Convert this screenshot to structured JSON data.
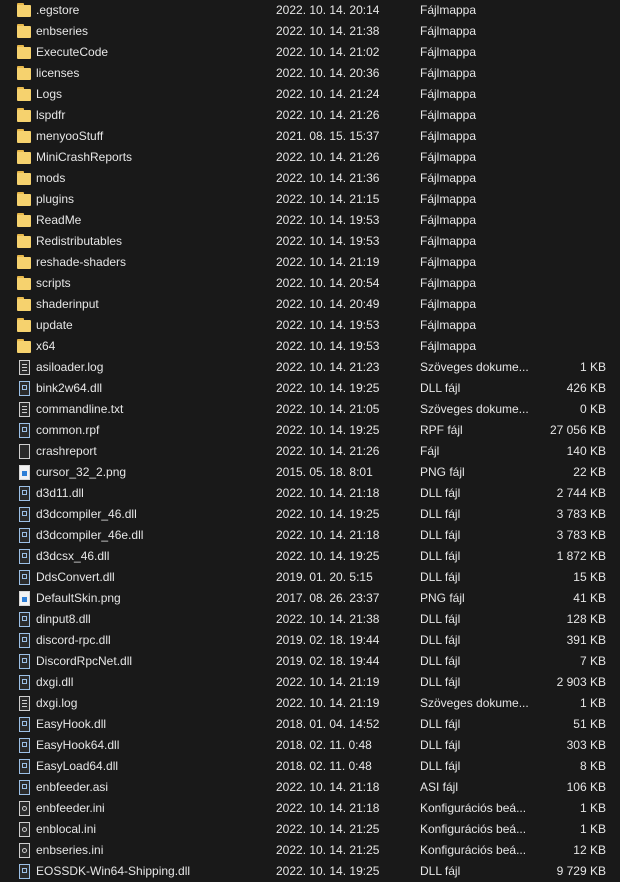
{
  "files": [
    {
      "name": ".egstore",
      "date": "2022. 10. 14. 20:14",
      "type": "Fájlmappa",
      "size": "",
      "icon": "folder-icon"
    },
    {
      "name": "enbseries",
      "date": "2022. 10. 14. 21:38",
      "type": "Fájlmappa",
      "size": "",
      "icon": "folder-icon"
    },
    {
      "name": "ExecuteCode",
      "date": "2022. 10. 14. 21:02",
      "type": "Fájlmappa",
      "size": "",
      "icon": "folder-icon"
    },
    {
      "name": "licenses",
      "date": "2022. 10. 14. 20:36",
      "type": "Fájlmappa",
      "size": "",
      "icon": "folder-icon"
    },
    {
      "name": "Logs",
      "date": "2022. 10. 14. 21:24",
      "type": "Fájlmappa",
      "size": "",
      "icon": "folder-icon"
    },
    {
      "name": "lspdfr",
      "date": "2022. 10. 14. 21:26",
      "type": "Fájlmappa",
      "size": "",
      "icon": "folder-icon"
    },
    {
      "name": "menyooStuff",
      "date": "2021. 08. 15. 15:37",
      "type": "Fájlmappa",
      "size": "",
      "icon": "folder-icon"
    },
    {
      "name": "MiniCrashReports",
      "date": "2022. 10. 14. 21:26",
      "type": "Fájlmappa",
      "size": "",
      "icon": "folder-icon"
    },
    {
      "name": "mods",
      "date": "2022. 10. 14. 21:36",
      "type": "Fájlmappa",
      "size": "",
      "icon": "folder-icon"
    },
    {
      "name": "plugins",
      "date": "2022. 10. 14. 21:15",
      "type": "Fájlmappa",
      "size": "",
      "icon": "folder-icon"
    },
    {
      "name": "ReadMe",
      "date": "2022. 10. 14. 19:53",
      "type": "Fájlmappa",
      "size": "",
      "icon": "folder-icon"
    },
    {
      "name": "Redistributables",
      "date": "2022. 10. 14. 19:53",
      "type": "Fájlmappa",
      "size": "",
      "icon": "folder-icon"
    },
    {
      "name": "reshade-shaders",
      "date": "2022. 10. 14. 21:19",
      "type": "Fájlmappa",
      "size": "",
      "icon": "folder-icon"
    },
    {
      "name": "scripts",
      "date": "2022. 10. 14. 20:54",
      "type": "Fájlmappa",
      "size": "",
      "icon": "folder-icon"
    },
    {
      "name": "shaderinput",
      "date": "2022. 10. 14. 20:49",
      "type": "Fájlmappa",
      "size": "",
      "icon": "folder-icon"
    },
    {
      "name": "update",
      "date": "2022. 10. 14. 19:53",
      "type": "Fájlmappa",
      "size": "",
      "icon": "folder-icon"
    },
    {
      "name": "x64",
      "date": "2022. 10. 14. 19:53",
      "type": "Fájlmappa",
      "size": "",
      "icon": "folder-icon"
    },
    {
      "name": "asiloader.log",
      "date": "2022. 10. 14. 21:23",
      "type": "Szöveges dokume...",
      "size": "1 KB",
      "icon": "text-file-icon"
    },
    {
      "name": "bink2w64.dll",
      "date": "2022. 10. 14. 19:25",
      "type": "DLL fájl",
      "size": "426 KB",
      "icon": "dll-file-icon"
    },
    {
      "name": "commandline.txt",
      "date": "2022. 10. 14. 21:05",
      "type": "Szöveges dokume...",
      "size": "0 KB",
      "icon": "text-file-icon"
    },
    {
      "name": "common.rpf",
      "date": "2022. 10. 14. 19:25",
      "type": "RPF fájl",
      "size": "27 056 KB",
      "icon": "dll-file-icon"
    },
    {
      "name": "crashreport",
      "date": "2022. 10. 14. 21:26",
      "type": "Fájl",
      "size": "140 KB",
      "icon": "blank-file-icon"
    },
    {
      "name": "cursor_32_2.png",
      "date": "2015. 05. 18. 8:01",
      "type": "PNG fájl",
      "size": "22 KB",
      "icon": "image-file-icon"
    },
    {
      "name": "d3d11.dll",
      "date": "2022. 10. 14. 21:18",
      "type": "DLL fájl",
      "size": "2 744 KB",
      "icon": "dll-file-icon"
    },
    {
      "name": "d3dcompiler_46.dll",
      "date": "2022. 10. 14. 19:25",
      "type": "DLL fájl",
      "size": "3 783 KB",
      "icon": "dll-file-icon"
    },
    {
      "name": "d3dcompiler_46e.dll",
      "date": "2022. 10. 14. 21:18",
      "type": "DLL fájl",
      "size": "3 783 KB",
      "icon": "dll-file-icon"
    },
    {
      "name": "d3dcsx_46.dll",
      "date": "2022. 10. 14. 19:25",
      "type": "DLL fájl",
      "size": "1 872 KB",
      "icon": "dll-file-icon"
    },
    {
      "name": "DdsConvert.dll",
      "date": "2019. 01. 20. 5:15",
      "type": "DLL fájl",
      "size": "15 KB",
      "icon": "dll-file-icon"
    },
    {
      "name": "DefaultSkin.png",
      "date": "2017. 08. 26. 23:37",
      "type": "PNG fájl",
      "size": "41 KB",
      "icon": "image-file-icon"
    },
    {
      "name": "dinput8.dll",
      "date": "2022. 10. 14. 21:38",
      "type": "DLL fájl",
      "size": "128 KB",
      "icon": "dll-file-icon"
    },
    {
      "name": "discord-rpc.dll",
      "date": "2019. 02. 18. 19:44",
      "type": "DLL fájl",
      "size": "391 KB",
      "icon": "dll-file-icon"
    },
    {
      "name": "DiscordRpcNet.dll",
      "date": "2019. 02. 18. 19:44",
      "type": "DLL fájl",
      "size": "7 KB",
      "icon": "dll-file-icon"
    },
    {
      "name": "dxgi.dll",
      "date": "2022. 10. 14. 21:19",
      "type": "DLL fájl",
      "size": "2 903 KB",
      "icon": "dll-file-icon"
    },
    {
      "name": "dxgi.log",
      "date": "2022. 10. 14. 21:19",
      "type": "Szöveges dokume...",
      "size": "1 KB",
      "icon": "text-file-icon"
    },
    {
      "name": "EasyHook.dll",
      "date": "2018. 01. 04. 14:52",
      "type": "DLL fájl",
      "size": "51 KB",
      "icon": "dll-file-icon"
    },
    {
      "name": "EasyHook64.dll",
      "date": "2018. 02. 11. 0:48",
      "type": "DLL fájl",
      "size": "303 KB",
      "icon": "dll-file-icon"
    },
    {
      "name": "EasyLoad64.dll",
      "date": "2018. 02. 11. 0:48",
      "type": "DLL fájl",
      "size": "8 KB",
      "icon": "dll-file-icon"
    },
    {
      "name": "enbfeeder.asi",
      "date": "2022. 10. 14. 21:18",
      "type": "ASI fájl",
      "size": "106 KB",
      "icon": "dll-file-icon"
    },
    {
      "name": "enbfeeder.ini",
      "date": "2022. 10. 14. 21:18",
      "type": "Konfigurációs beá...",
      "size": "1 KB",
      "icon": "config-file-icon"
    },
    {
      "name": "enblocal.ini",
      "date": "2022. 10. 14. 21:25",
      "type": "Konfigurációs beá...",
      "size": "1 KB",
      "icon": "config-file-icon"
    },
    {
      "name": "enbseries.ini",
      "date": "2022. 10. 14. 21:25",
      "type": "Konfigurációs beá...",
      "size": "12 KB",
      "icon": "config-file-icon"
    },
    {
      "name": "EOSSDK-Win64-Shipping.dll",
      "date": "2022. 10. 14. 19:25",
      "type": "DLL fájl",
      "size": "9 729 KB",
      "icon": "dll-file-icon"
    }
  ]
}
